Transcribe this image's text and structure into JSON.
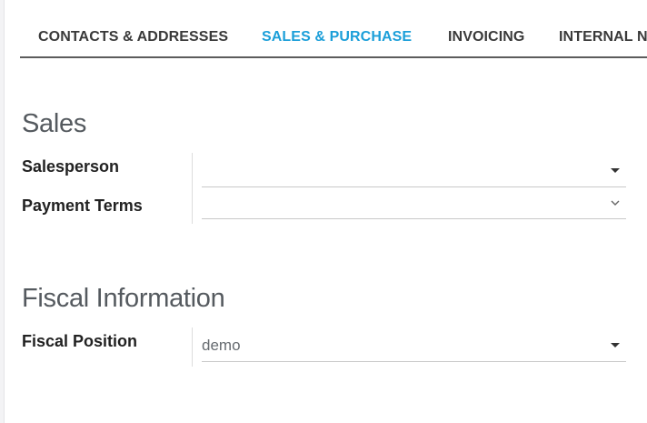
{
  "tabs": [
    {
      "label": "CONTACTS & ADDRESSES",
      "active": false
    },
    {
      "label": "SALES & PURCHASE",
      "active": true
    },
    {
      "label": "INVOICING",
      "active": false
    },
    {
      "label": "INTERNAL N",
      "active": false
    }
  ],
  "colors": {
    "accent": "#1c9fd9",
    "tab_text": "#3a3a3a",
    "section_title": "#555a5f"
  },
  "sales": {
    "title": "Sales",
    "salesperson": {
      "label": "Salesperson",
      "value": "",
      "icon": "caret-down-icon"
    },
    "payment_terms": {
      "label": "Payment Terms",
      "value": "",
      "icon": "chevron-down-icon"
    }
  },
  "fiscal": {
    "title": "Fiscal Information",
    "fiscal_position": {
      "label": "Fiscal Position",
      "value": "demo",
      "icon": "caret-down-icon"
    }
  }
}
